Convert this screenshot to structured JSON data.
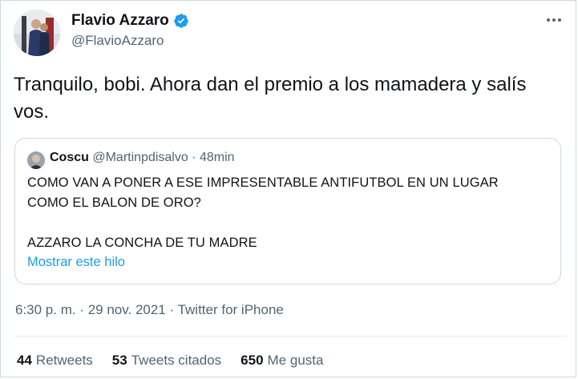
{
  "author": {
    "name": "Flavio Azzaro",
    "handle": "@FlavioAzzaro",
    "verified": true
  },
  "tweet": {
    "text": "Tranquilo, bobi. Ahora dan el premio a los mamadera y salís vos."
  },
  "quoted": {
    "name": "Coscu",
    "handle": "@Martinpdisalvo",
    "separator": "·",
    "time": "48min",
    "lines": [
      "COMO VAN A PONER A ESE IMPRESENTABLE ANTIFUTBOL EN UN LUGAR",
      "COMO EL BALON DE ORO?",
      "AZZARO LA CONCHA DE TU MADRE"
    ],
    "show_thread": "Mostrar este hilo"
  },
  "meta": {
    "time": "6:30 p. m.",
    "sep1": " · ",
    "date": "29 nov. 2021",
    "sep2": " · ",
    "source": "Twitter for iPhone"
  },
  "stats": {
    "retweets_count": "44",
    "retweets_label": "Retweets",
    "quotes_count": "53",
    "quotes_label": "Tweets citados",
    "likes_count": "650",
    "likes_label": "Me gusta"
  },
  "colors": {
    "accent": "#1d9bf0",
    "secondary_text": "#536471",
    "primary_text": "#0f1419",
    "border": "#cfd9de"
  },
  "icons": {
    "verified": "verified-badge-icon",
    "more": "more-options-icon"
  }
}
